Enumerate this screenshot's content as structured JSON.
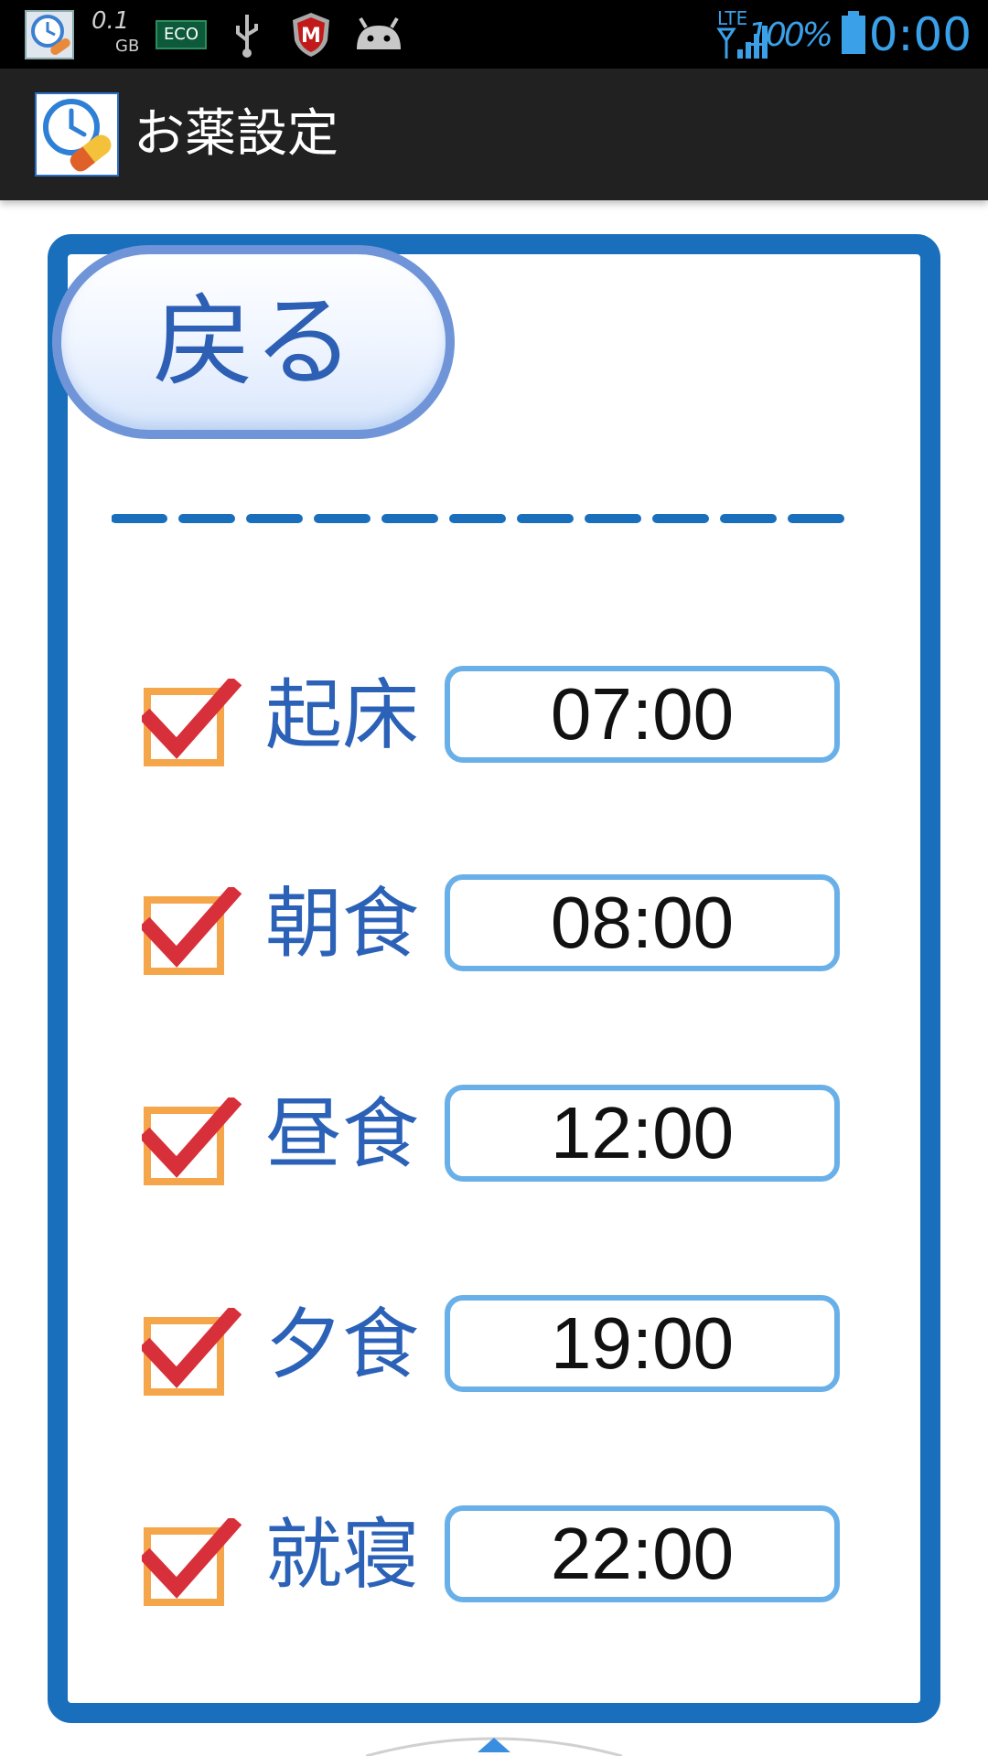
{
  "status_bar": {
    "data_usage_value": "0.1",
    "data_usage_unit": "GB",
    "eco_label": "ECO",
    "network": "LTE",
    "battery_percent": "100%",
    "clock": "0:00",
    "clock_color": "#3aa0e8"
  },
  "action_bar": {
    "title": "お薬設定"
  },
  "back_button": {
    "label": "戻る"
  },
  "schedule": [
    {
      "label": "起床",
      "time": "07:00",
      "checked": true
    },
    {
      "label": "朝食",
      "time": "08:00",
      "checked": true
    },
    {
      "label": "昼食",
      "time": "12:00",
      "checked": true
    },
    {
      "label": "夕食",
      "time": "19:00",
      "checked": true
    },
    {
      "label": "就寝",
      "time": "22:00",
      "checked": true
    }
  ],
  "colors": {
    "frame": "#1a6fbc",
    "label_text": "#2b62b8",
    "checkbox_box": "#f5a64a",
    "checkmark": "#d8303a",
    "time_border": "#6ab0e8"
  }
}
